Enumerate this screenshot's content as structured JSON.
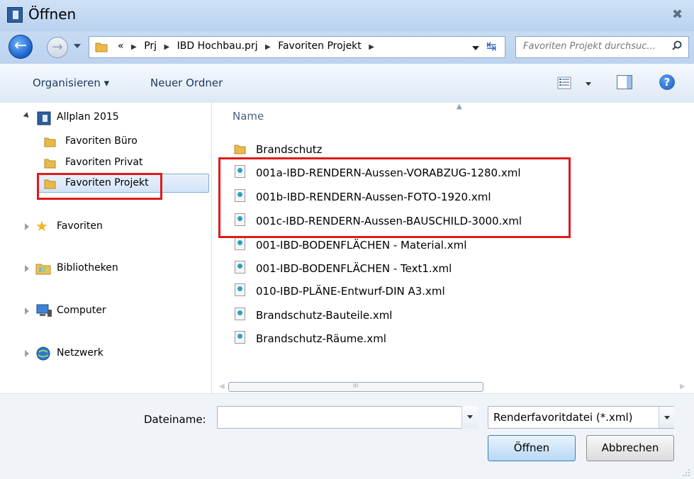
{
  "window": {
    "title": "Öffnen",
    "close_glyph": "✖"
  },
  "address_bar": {
    "overflow": "«",
    "breadcrumbs": [
      "Prj",
      "IBD Hochbau.prj",
      "Favoriten Projekt"
    ],
    "separator": "▶",
    "search_placeholder": "Favoriten Projekt durchsuc..."
  },
  "toolbar": {
    "organize_label": "Organisieren ▾",
    "new_folder_label": "Neuer Ordner"
  },
  "nav": {
    "root": "Allplan 2015",
    "children": [
      "Favoriten Büro",
      "Favoriten Privat",
      "Favoriten Projekt"
    ],
    "selected": "Favoriten Projekt",
    "groups": [
      "Favoriten",
      "Bibliotheken",
      "Computer",
      "Netzwerk"
    ]
  },
  "files": {
    "column_name": "Name",
    "folders": [
      "Brandschutz"
    ],
    "items": [
      "001a-IBD-RENDERN-Aussen-VORABZUG-1280.xml",
      "001b-IBD-RENDERN-Aussen-FOTO-1920.xml",
      "001c-IBD-RENDERN-Aussen-BAUSCHILD-3000.xml",
      "001-IBD-BODENFLÄCHEN - Material.xml",
      "001-IBD-BODENFLÄCHEN - Text1.xml",
      "010-IBD-PLÄNE-Entwurf-DIN A3.xml",
      "Brandschutz-Bauteile.xml",
      "Brandschutz-Räume.xml"
    ],
    "scroll_grip": "III"
  },
  "bottom": {
    "filename_label": "Dateiname:",
    "filename_value": "",
    "filetype": "Renderfavoritdatei (*.xml)",
    "open_label": "Öffnen",
    "cancel_label": "Abbrechen"
  },
  "colors": {
    "highlight_red": "#e01a1a",
    "folder_yellow": "#e9b949",
    "title_gradient_top": "#cfe1f6"
  }
}
